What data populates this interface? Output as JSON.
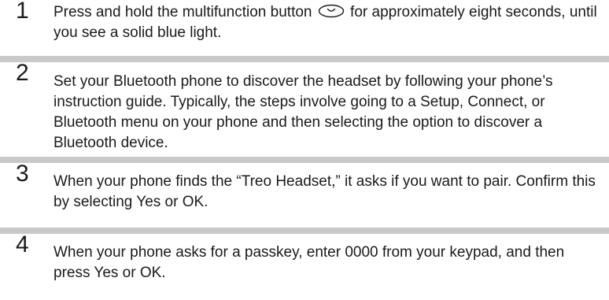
{
  "steps": [
    {
      "number": "1",
      "text_before_icon": "Press and hold the multifunction button",
      "icon": "multifunction-button-icon",
      "text_after_icon": "for approximately eight seconds, until you see a solid blue light."
    },
    {
      "number": "2",
      "text": "Set your Bluetooth phone to discover the headset by following your phone’s instruction guide. Typically, the steps involve going to a Setup, Connect, or Bluetooth menu on your phone and then selecting the option to discover a Bluetooth device."
    },
    {
      "number": "3",
      "text": "When your phone finds the “Treo Headset,” it asks if you want to pair. Confirm this by selecting Yes or OK."
    },
    {
      "number": "4",
      "text": "When your phone asks for a passkey, enter 0000 from your keypad, and then press Yes or OK."
    }
  ]
}
